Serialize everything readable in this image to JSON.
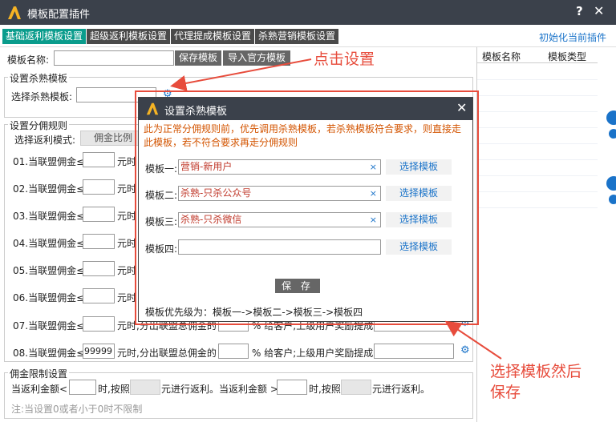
{
  "window": {
    "title": "模板配置插件",
    "help": "?",
    "close": "✕"
  },
  "tabs": [
    {
      "label": "基础返利模板设置",
      "active": true
    },
    {
      "label": "超级返利模板设置",
      "active": false
    },
    {
      "label": "代理提成模板设置",
      "active": false
    },
    {
      "label": "杀熟营销模板设置",
      "active": false
    }
  ],
  "init_link": "初始化当前插件",
  "template_name": {
    "label": "模板名称:",
    "save_btn": "保存模板",
    "import_btn": "导入官方模板"
  },
  "sha_shu": {
    "legend": "设置杀熟模板",
    "label": "选择杀熟模板:"
  },
  "fenyong": {
    "legend": "设置分佣规则",
    "mode_label": "选择返利模式:",
    "mode_value": "佣金比例",
    "rows": [
      {
        "label": "01.当联盟佣金≤",
        "value": "",
        "suffix": "元时"
      },
      {
        "label": "02.当联盟佣金≤",
        "value": "",
        "suffix": "元时"
      },
      {
        "label": "03.当联盟佣金≤",
        "value": "",
        "suffix": "元时"
      },
      {
        "label": "04.当联盟佣金≤",
        "value": "",
        "suffix": "元时"
      },
      {
        "label": "05.当联盟佣金≤",
        "value": "",
        "suffix": "元时"
      },
      {
        "label": "06.当联盟佣金≤",
        "value": "",
        "suffix": "元时"
      },
      {
        "label": "07.当联盟佣金≤",
        "value": "",
        "suffix": "元时,分出联盟总佣金的"
      },
      {
        "label": "08.当联盟佣金≤",
        "value": "99999",
        "suffix": "元时,分出联盟总佣金的"
      }
    ],
    "pct_suffix": "% 给客户;上级用户奖励提成"
  },
  "limit": {
    "legend": "佣金限制设置",
    "a1": "当返利金额<",
    "a2": "时,按照",
    "a3": "元进行返利。当返利金额 >",
    "a4": "时,按照",
    "a5": "元进行返利。",
    "note": "注:当设置0或者小于0时不限制"
  },
  "right_panel": {
    "col1": "模板名称",
    "col2": "模板类型"
  },
  "modal": {
    "title": "设置杀熟模板",
    "close": "✕",
    "note": "此为正常分佣规则前，优先调用杀熟模板，若杀熟模板符合要求，则直接走此模板，若不符合要求再走分佣规则",
    "slots": [
      {
        "label": "模板一:",
        "value": "营销-新用户",
        "clear": "×",
        "pick": "选择模板"
      },
      {
        "label": "模板二:",
        "value": "杀熟-只杀公众号",
        "clear": "×",
        "pick": "选择模板"
      },
      {
        "label": "模板三:",
        "value": "杀熟-只杀微信",
        "clear": "×",
        "pick": "选择模板"
      },
      {
        "label": "模板四:",
        "value": "",
        "clear": "",
        "pick": "选择模板"
      }
    ],
    "save": "保 存",
    "priority": "模板优先级为：模板一->模板二->模板三->模板四"
  },
  "annotations": {
    "click_settings": "点击设置",
    "select_save_1": "选择模板然后",
    "select_save_2": "保存"
  },
  "colors": {
    "accent": "#0a9c8c",
    "titlebar": "#3b414b",
    "annotation": "#e74c3c",
    "link": "#1a73c9"
  }
}
